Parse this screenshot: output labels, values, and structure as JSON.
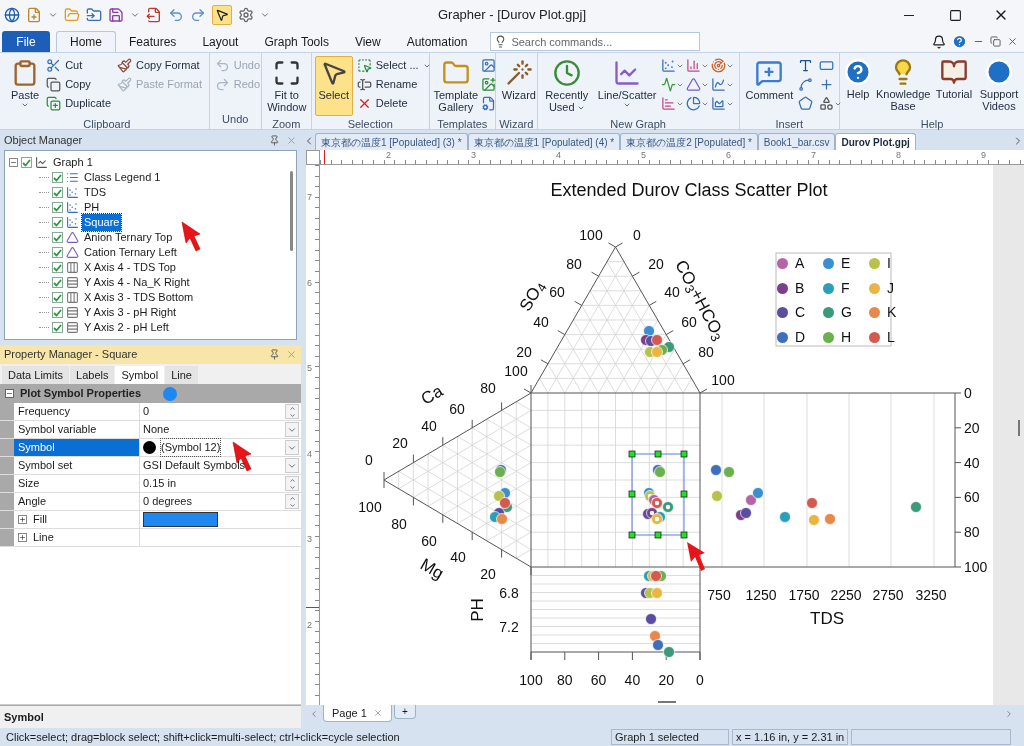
{
  "window": {
    "title": "Grapher - [Durov Plot.gpj]"
  },
  "quick_select": {
    "selected": true
  },
  "ribbon_tabs": [
    {
      "label": "File",
      "kind": "menu",
      "selected": false
    },
    {
      "label": "Home",
      "kind": "tab",
      "selected": true
    },
    {
      "label": "Features",
      "kind": "tab",
      "selected": false
    },
    {
      "label": "Layout",
      "kind": "tab",
      "selected": false
    },
    {
      "label": "Graph Tools",
      "kind": "tab",
      "selected": false
    },
    {
      "label": "View",
      "kind": "tab",
      "selected": false
    },
    {
      "label": "Automation",
      "kind": "tab",
      "selected": false
    }
  ],
  "search": {
    "placeholder": "Search commands..."
  },
  "clipboard": {
    "label": "Clipboard",
    "paste": "Paste",
    "items": [
      {
        "label": "Cut",
        "disabled": false
      },
      {
        "label": "Copy",
        "disabled": false
      },
      {
        "label": "Duplicate",
        "disabled": false
      },
      {
        "label": "Copy Format",
        "disabled": false
      },
      {
        "label": "Paste Format",
        "disabled": true
      }
    ]
  },
  "undo": {
    "label": "Undo",
    "items": [
      {
        "label": "Undo",
        "disabled": true
      },
      {
        "label": "Redo",
        "disabled": true
      }
    ]
  },
  "zoom": {
    "label": "Zoom",
    "button": "Fit to Window"
  },
  "selection": {
    "label": "Selection",
    "select": {
      "label": "Select",
      "selected": true
    },
    "items": [
      "Select ...",
      "Rename",
      "Delete"
    ]
  },
  "templates": {
    "label": "Templates",
    "button": "Template Gallery"
  },
  "wizard": {
    "label": "Wizard",
    "button": "Wizard"
  },
  "new_graph": {
    "label": "New Graph",
    "buttons": [
      "Recently Used",
      "Line/Scatter"
    ]
  },
  "insert": {
    "label": "Insert",
    "button": "Comment"
  },
  "help": {
    "label": "Help",
    "buttons": [
      "Help",
      "Knowledge Base",
      "Tutorial",
      "Support Videos"
    ]
  },
  "object_manager": {
    "title": "Object Manager",
    "tree": [
      {
        "label": "Graph 1",
        "kind": "graph",
        "checked": true,
        "expanded": true,
        "selected": false,
        "children": [
          {
            "label": "Class Legend 1",
            "kind": "legend",
            "checked": true,
            "selected": false
          },
          {
            "label": "TDS",
            "kind": "scatter",
            "checked": true,
            "selected": false
          },
          {
            "label": "PH",
            "kind": "scatter",
            "checked": true,
            "selected": false
          },
          {
            "label": "Square",
            "kind": "scatter",
            "checked": true,
            "selected": true
          },
          {
            "label": "Anion Ternary Top",
            "kind": "ternary",
            "checked": true,
            "selected": false
          },
          {
            "label": "Cation Ternary Left",
            "kind": "ternary",
            "checked": true,
            "selected": false
          },
          {
            "label": "X Axis 4 - TDS Top",
            "kind": "x_axis",
            "checked": true,
            "selected": false
          },
          {
            "label": "Y Axis 4 - Na_K Right",
            "kind": "y_axis",
            "checked": true,
            "selected": false
          },
          {
            "label": "X Axis 3 - TDS Bottom",
            "kind": "x_axis",
            "checked": true,
            "selected": false
          },
          {
            "label": "Y Axis 3 - pH Right",
            "kind": "y_axis",
            "checked": true,
            "selected": false
          },
          {
            "label": "Y Axis 2 - pH Left",
            "kind": "y_axis",
            "checked": true,
            "selected": false
          }
        ]
      }
    ]
  },
  "property_manager": {
    "title": "Property Manager - Square",
    "tabs": [
      {
        "label": "Data Limits",
        "selected": false
      },
      {
        "label": "Labels",
        "selected": false
      },
      {
        "label": "Symbol",
        "selected": true
      },
      {
        "label": "Line",
        "selected": false
      }
    ],
    "section": {
      "label": "Plot Symbol Properties",
      "expanded": true,
      "color": "#1e88f0"
    },
    "rows": [
      {
        "kind": "spin",
        "name": "Frequency",
        "value": "0",
        "selected": false
      },
      {
        "kind": "dropdown",
        "name": "Symbol variable",
        "value": "None",
        "selected": false
      },
      {
        "kind": "symbol",
        "name": "Symbol",
        "value": "(Symbol 12)",
        "selected": true
      },
      {
        "kind": "dropdown",
        "name": "Symbol set",
        "value": "GSI Default Symbols",
        "selected": false
      },
      {
        "kind": "spin",
        "name": "Size",
        "value": "0.15 in",
        "selected": false
      },
      {
        "kind": "spin",
        "name": "Angle",
        "value": "0 degrees",
        "selected": false
      },
      {
        "kind": "swatch",
        "name": "Fill",
        "color": "#1e88f0",
        "expanded": false,
        "selected": false
      },
      {
        "kind": "group",
        "name": "Line",
        "expanded": false,
        "selected": false
      }
    ]
  },
  "description": "Symbol",
  "doc_tabs": [
    {
      "label": "東京都の温度1 [Populated] (3) *",
      "selected": false
    },
    {
      "label": "東京都の温度1 [Populated] (4) *",
      "selected": false
    },
    {
      "label": "東京都の温度2 [Populated] *",
      "selected": false
    },
    {
      "label": "Book1_bar.csv",
      "selected": false
    },
    {
      "label": "Durov Plot.gpj",
      "selected": true
    }
  ],
  "ruler": {
    "horizontal": [
      "2",
      "3",
      "4",
      "5",
      "6",
      "7",
      "8",
      "9"
    ],
    "vertical": [
      "7",
      "6",
      "5",
      "4",
      "3",
      "2"
    ]
  },
  "plot": {
    "title": "Extended Durov Class Scatter Plot",
    "so4": {
      "label": "SO$_{4}$",
      "ticks": [
        "100",
        "80",
        "60",
        "40",
        "20"
      ]
    },
    "co3": {
      "label": "CO$_{3}$+HCO$_{3}$",
      "ticks": [
        "0",
        "20",
        "40",
        "60",
        "80",
        "100"
      ]
    },
    "ca": {
      "label": "Ca",
      "ticks": [
        "100",
        "80",
        "60",
        "40",
        "20",
        "0"
      ]
    },
    "mg": {
      "label": "Mg",
      "ticks": [
        "100",
        "80",
        "60",
        "40",
        "20"
      ]
    },
    "ph": {
      "label": "PH",
      "ticks": [
        "6.8",
        "7.2"
      ]
    },
    "bottom_ticks": [
      "100",
      "80",
      "60",
      "40",
      "20",
      "0"
    ],
    "tds": {
      "label": "TDS",
      "ticks": [
        "750",
        "1250",
        "1750",
        "2250",
        "2750",
        "3250"
      ]
    },
    "right_ticks": [
      "0",
      "20",
      "40",
      "60",
      "80",
      "100"
    ],
    "legend": [
      {
        "label": "A",
        "color": "#b565a7"
      },
      {
        "label": "B",
        "color": "#7b3f8c"
      },
      {
        "label": "C",
        "color": "#5b4ea0"
      },
      {
        "label": "D",
        "color": "#3f6fba"
      },
      {
        "label": "E",
        "color": "#3a8fd0"
      },
      {
        "label": "F",
        "color": "#2aa0b8"
      },
      {
        "label": "G",
        "color": "#3a9a7a"
      },
      {
        "label": "H",
        "color": "#6ab04c"
      },
      {
        "label": "I",
        "color": "#b8c24a"
      },
      {
        "label": "J",
        "color": "#eab543"
      },
      {
        "label": "K",
        "color": "#e8894a"
      },
      {
        "label": "L",
        "color": "#d35a4f"
      }
    ]
  },
  "page_tabs": [
    {
      "label": "Page 1",
      "selected": true
    }
  ],
  "add_page": "+",
  "status_bar": [
    "Click=select; drag=block select; shift+click=multi-select; ctrl+click=cycle selection",
    "Graph 1 selected",
    "x = 1.16 in, y = 2.31 in"
  ]
}
